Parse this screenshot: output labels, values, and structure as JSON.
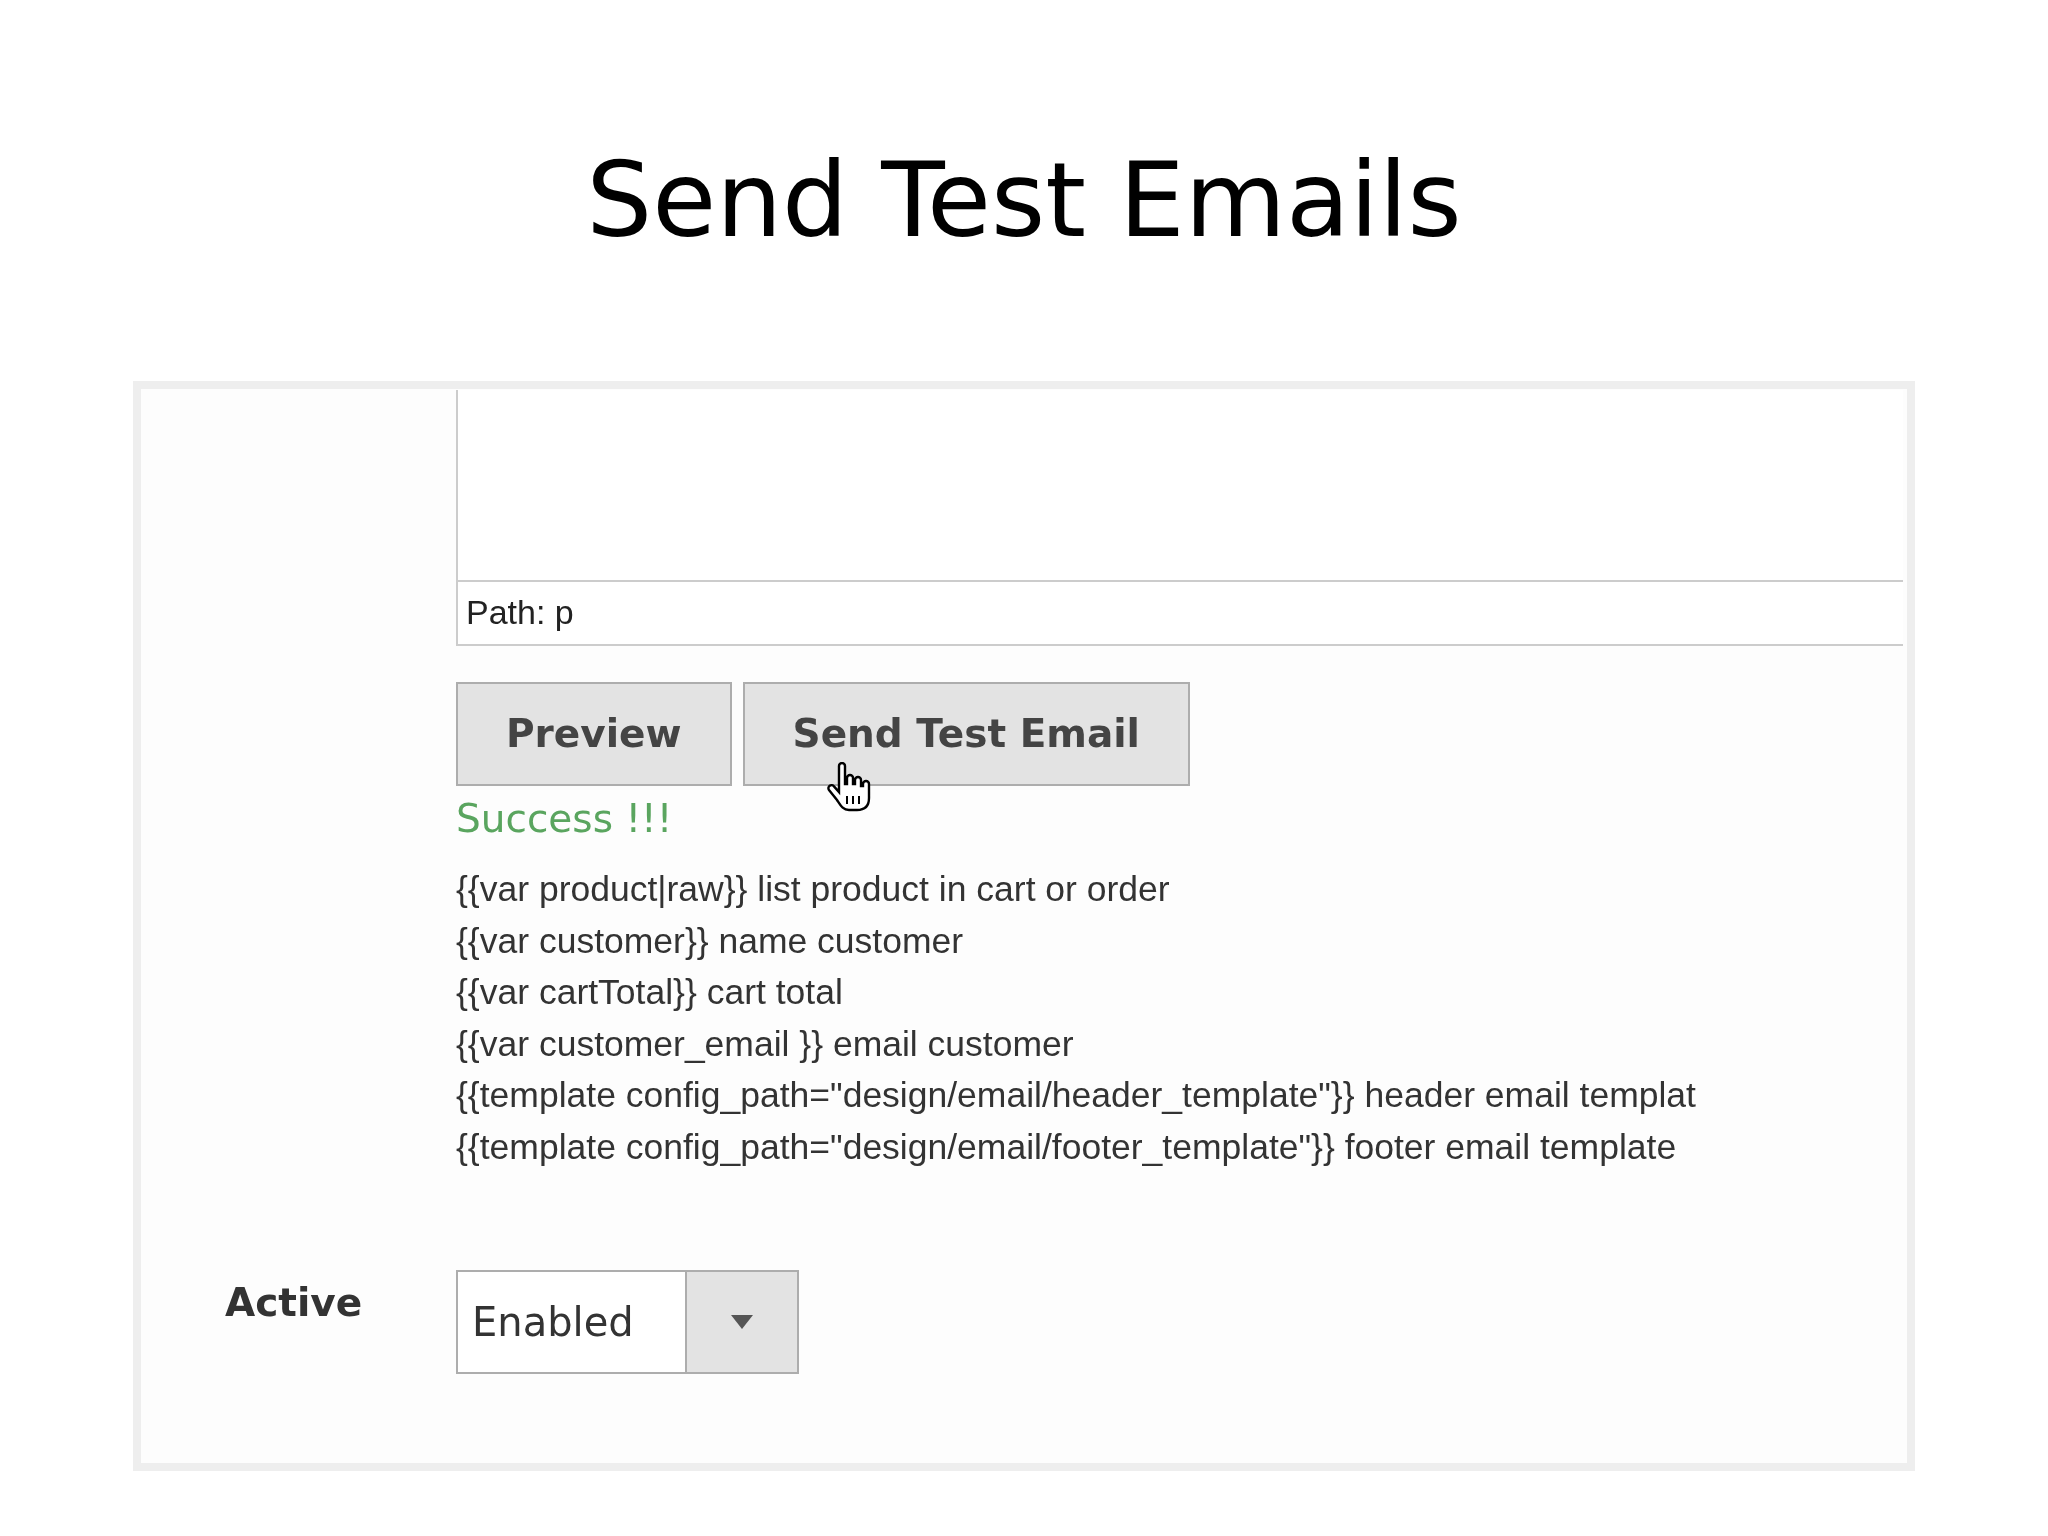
{
  "slide_title": "Send Test Emails",
  "editor": {
    "path": "Path: p"
  },
  "buttons": [
    {
      "label": "Preview"
    },
    {
      "label": "Send Test Email"
    }
  ],
  "status": "Success !!!",
  "help_lines": [
    "{{var product|raw}} list product in cart or order",
    "{{var customer}} name customer",
    "{{var cartTotal}} cart total",
    "{{var customer_email }} email customer",
    "{{template config_path=\"design/email/header_template\"}} header email templat",
    "{{template config_path=\"design/email/footer_template\"}} footer email template"
  ],
  "active": {
    "label": "Active",
    "value": "Enabled"
  }
}
